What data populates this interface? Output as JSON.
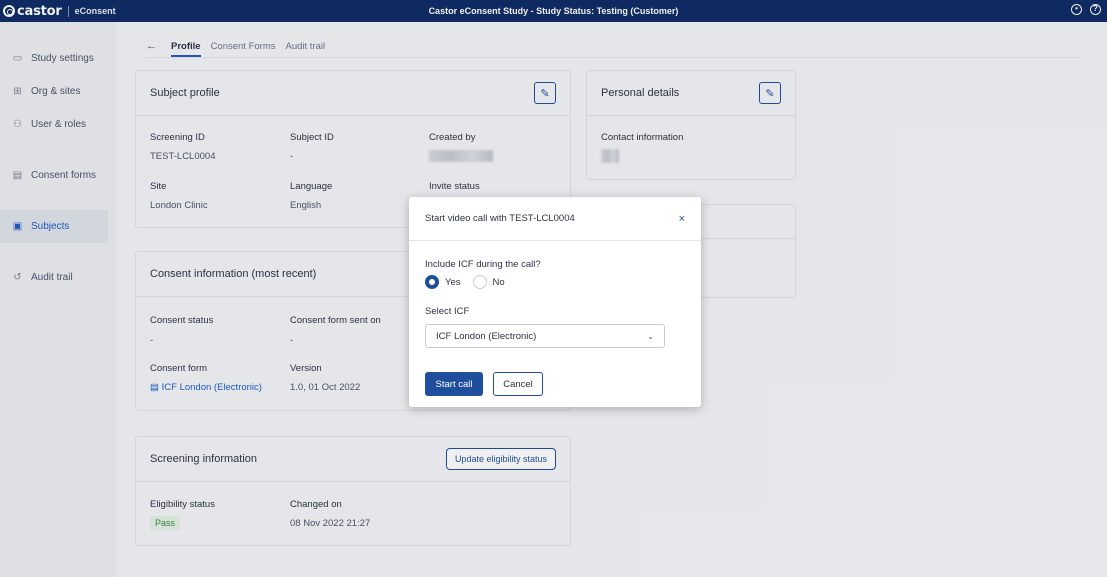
{
  "app": {
    "brand": "castor",
    "product": "eConsent",
    "title": "Castor eConsent Study  - Study Status: Testing (Customer)"
  },
  "topbar_icons": [
    "account-icon",
    "help-icon"
  ],
  "sidebar": {
    "items": [
      {
        "label": "Study settings",
        "icon": "settings-icon"
      },
      {
        "label": "Org & sites",
        "icon": "building-icon"
      },
      {
        "label": "User & roles",
        "icon": "users-icon"
      },
      {
        "label": "Consent forms",
        "icon": "document-icon"
      },
      {
        "label": "Subjects",
        "icon": "subjects-icon",
        "active": true
      },
      {
        "label": "Audit trail",
        "icon": "history-icon"
      }
    ]
  },
  "tabs": [
    {
      "label": "Profile",
      "active": true
    },
    {
      "label": "Consent Forms"
    },
    {
      "label": "Audit trail"
    }
  ],
  "subject_profile": {
    "title": "Subject profile",
    "screening_id_label": "Screening ID",
    "screening_id": "TEST-LCL0004",
    "subject_id_label": "Subject ID",
    "subject_id": "-",
    "created_by_label": "Created by",
    "site_label": "Site",
    "site": "London Clinic",
    "language_label": "Language",
    "language": "English",
    "invite_status_label": "Invite status"
  },
  "personal_details": {
    "title": "Personal details",
    "contact_label": "Contact information"
  },
  "consent_info": {
    "title": "Consent information (most recent)",
    "status_label": "Consent status",
    "status": "-",
    "sent_on_label": "Consent form sent on",
    "sent_on": "-",
    "form_label": "Consent form",
    "form": "ICF London (Electronic)",
    "version_label": "Version",
    "version": "1.0, 01 Oct 2022"
  },
  "screening_info": {
    "title": "Screening information",
    "update_button": "Update eligibility status",
    "eligibility_label": "Eligibility status",
    "eligibility": "Pass",
    "changed_label": "Changed on",
    "changed": "08 Nov 2022 21:27"
  },
  "modal": {
    "title": "Start video call with TEST-LCL0004",
    "close": "×",
    "question": "Include ICF during the call?",
    "yes": "Yes",
    "no": "No",
    "selected": "Yes",
    "select_label": "Select ICF",
    "select_value": "ICF London (Electronic)",
    "start_button": "Start call",
    "cancel_button": "Cancel"
  }
}
